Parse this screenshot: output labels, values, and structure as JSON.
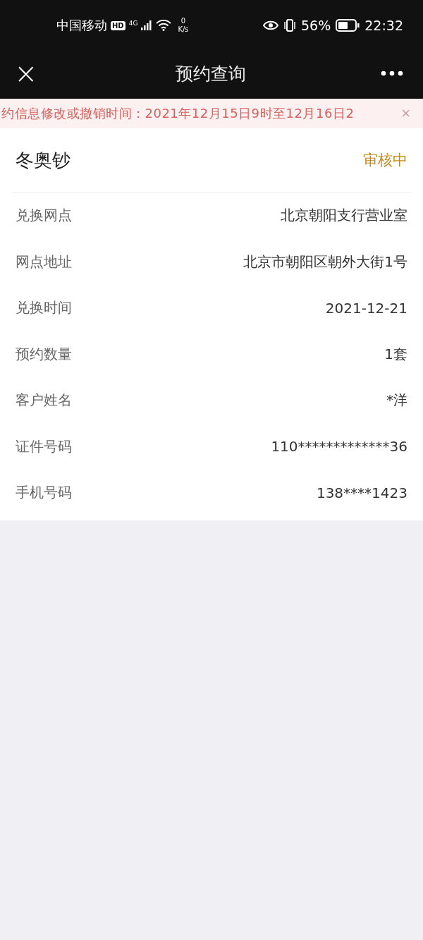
{
  "status_bar": {
    "carrier": "中国移动",
    "hd": "HD",
    "network": "4G",
    "speed_value": "0",
    "speed_unit": "K/s",
    "battery": "56%",
    "time": "22:32"
  },
  "nav": {
    "close": "×",
    "title": "预约查询"
  },
  "notice": {
    "text": "约信息修改或撤销时间：2021年12月15日9时至12月16日2",
    "close": "×"
  },
  "card": {
    "product": "冬奥钞",
    "status": "审核中",
    "rows": [
      {
        "label": "兑换网点",
        "value": "北京朝阳支行营业室"
      },
      {
        "label": "网点地址",
        "value": "北京市朝阳区朝外大街1号"
      },
      {
        "label": "兑换时间",
        "value": "2021-12-21"
      },
      {
        "label": "预约数量",
        "value": "1套"
      },
      {
        "label": "客户姓名",
        "value": "*洋"
      },
      {
        "label": "证件号码",
        "value": "110*************36"
      },
      {
        "label": "手机号码",
        "value": "138****1423"
      }
    ]
  }
}
